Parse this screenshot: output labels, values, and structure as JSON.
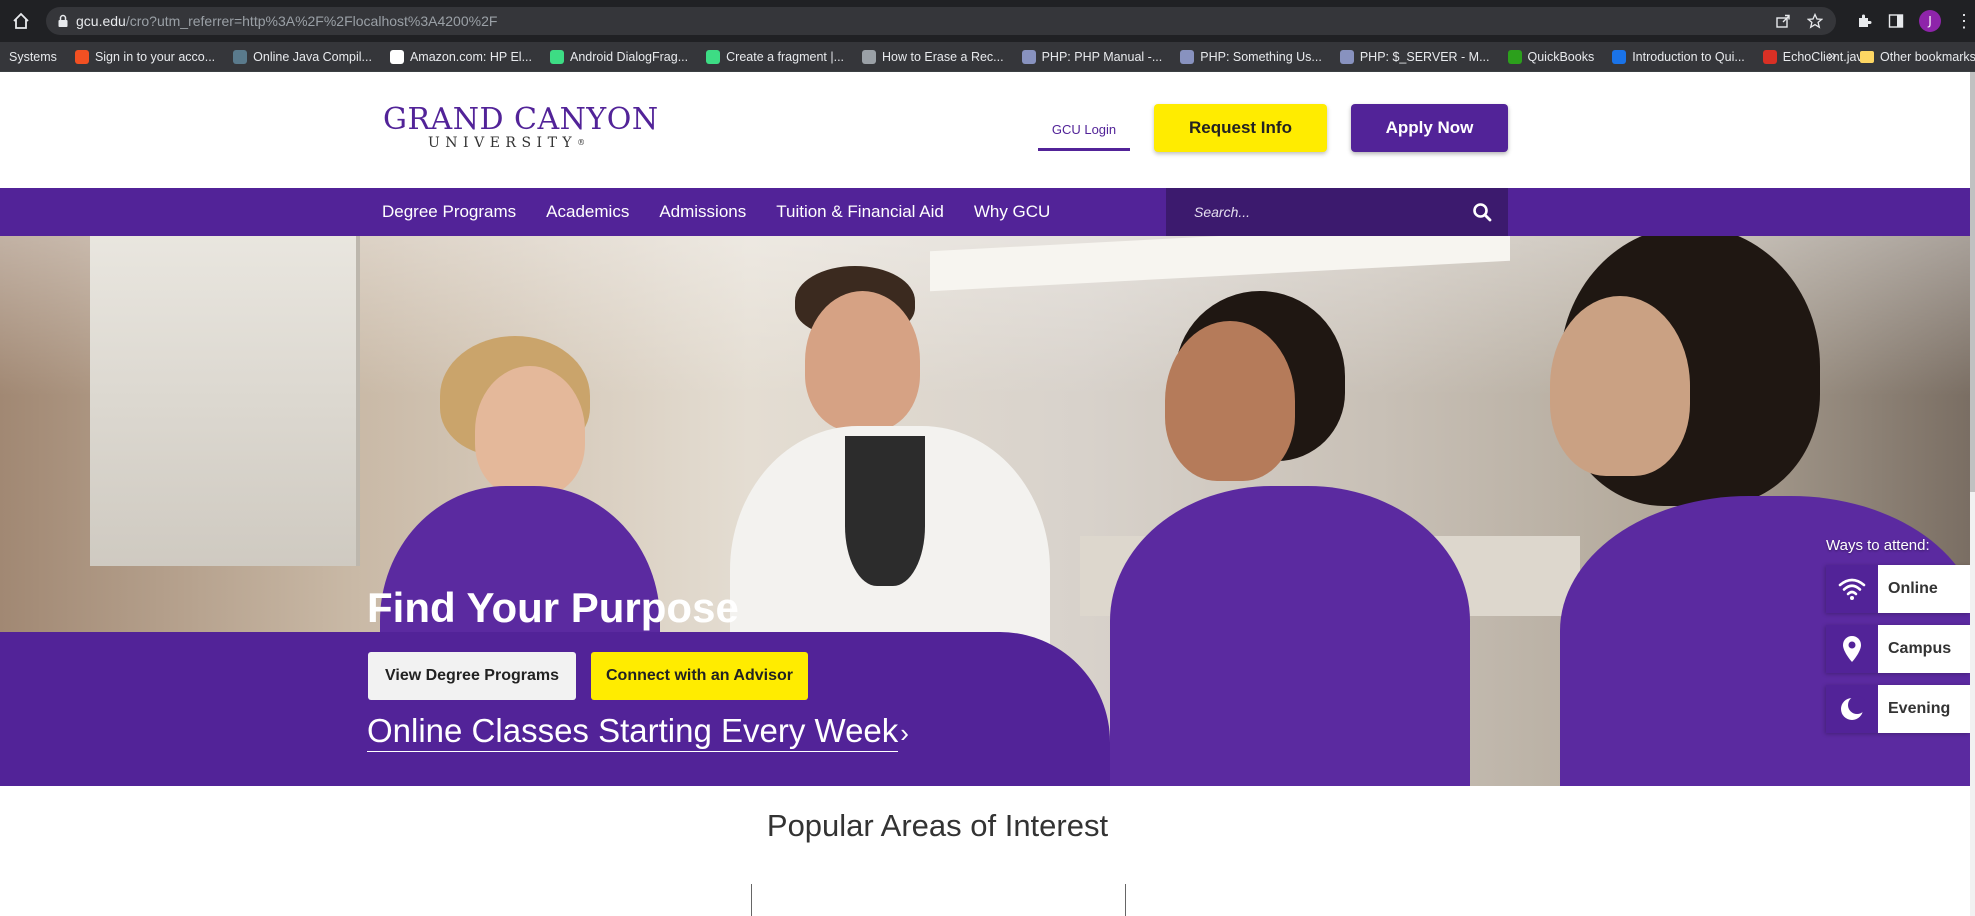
{
  "browser": {
    "url_domain": "gcu.edu",
    "url_path": "/cro?utm_referrer=http%3A%2F%2Flocalhost%3A4200%2F",
    "bookmarks": [
      {
        "label": "Systems",
        "icon": "none"
      },
      {
        "label": "Sign in to your acco...",
        "icon": "microsoft-icon",
        "color": "#f25022"
      },
      {
        "label": "Online Java Compil...",
        "icon": "java-icon",
        "color": "#5a7a8c"
      },
      {
        "label": "Amazon.com: HP El...",
        "icon": "amazon-icon",
        "color": "#ffffff"
      },
      {
        "label": "Android DialogFrag...",
        "icon": "android-dev-icon",
        "color": "#3ddc84"
      },
      {
        "label": "Create a fragment |...",
        "icon": "android-icon",
        "color": "#3ddc84"
      },
      {
        "label": "How to Erase a Rec...",
        "icon": "globe-icon",
        "color": "#9aa0a6"
      },
      {
        "label": "PHP: PHP Manual -...",
        "icon": "php-icon",
        "color": "#8892bf"
      },
      {
        "label": "PHP: Something Us...",
        "icon": "php-icon",
        "color": "#8892bf"
      },
      {
        "label": "PHP: $_SERVER - M...",
        "icon": "php-icon",
        "color": "#8892bf"
      },
      {
        "label": "QuickBooks",
        "icon": "quickbooks-icon",
        "color": "#2ca01c"
      },
      {
        "label": "Introduction to Qui...",
        "icon": "quill-icon",
        "color": "#1a73e8"
      },
      {
        "label": "EchoClient.java",
        "icon": "oracle-icon",
        "color": "#d93025"
      }
    ],
    "bookmarks_overflow": "»",
    "other_bookmarks": "Other bookmarks",
    "profile_initial": "J"
  },
  "header": {
    "logo_main": "GRAND CANYON",
    "logo_sub": "UNIVERSITY",
    "logo_reg": "®",
    "login_label": "GCU Login",
    "request_label": "Request Info",
    "apply_label": "Apply Now"
  },
  "nav": {
    "items": [
      "Degree Programs",
      "Academics",
      "Admissions",
      "Tuition & Financial Aid",
      "Why GCU"
    ],
    "search_placeholder": "Search..."
  },
  "hero": {
    "title": "Find Your Purpose",
    "view_label": "View Degree Programs",
    "connect_label": "Connect with an Advisor",
    "online_classes": "Online Classes Starting Every Week",
    "online_chevron": "›"
  },
  "attend": {
    "label": "Ways to attend:",
    "options": [
      {
        "label": "Online",
        "icon": "wifi-icon"
      },
      {
        "label": "Campus",
        "icon": "map-pin-icon"
      },
      {
        "label": "Evening",
        "icon": "moon-icon"
      }
    ]
  },
  "popular": {
    "title": "Popular Areas of Interest"
  },
  "colors": {
    "brand_purple": "#522398",
    "brand_yellow": "#ffec00"
  }
}
